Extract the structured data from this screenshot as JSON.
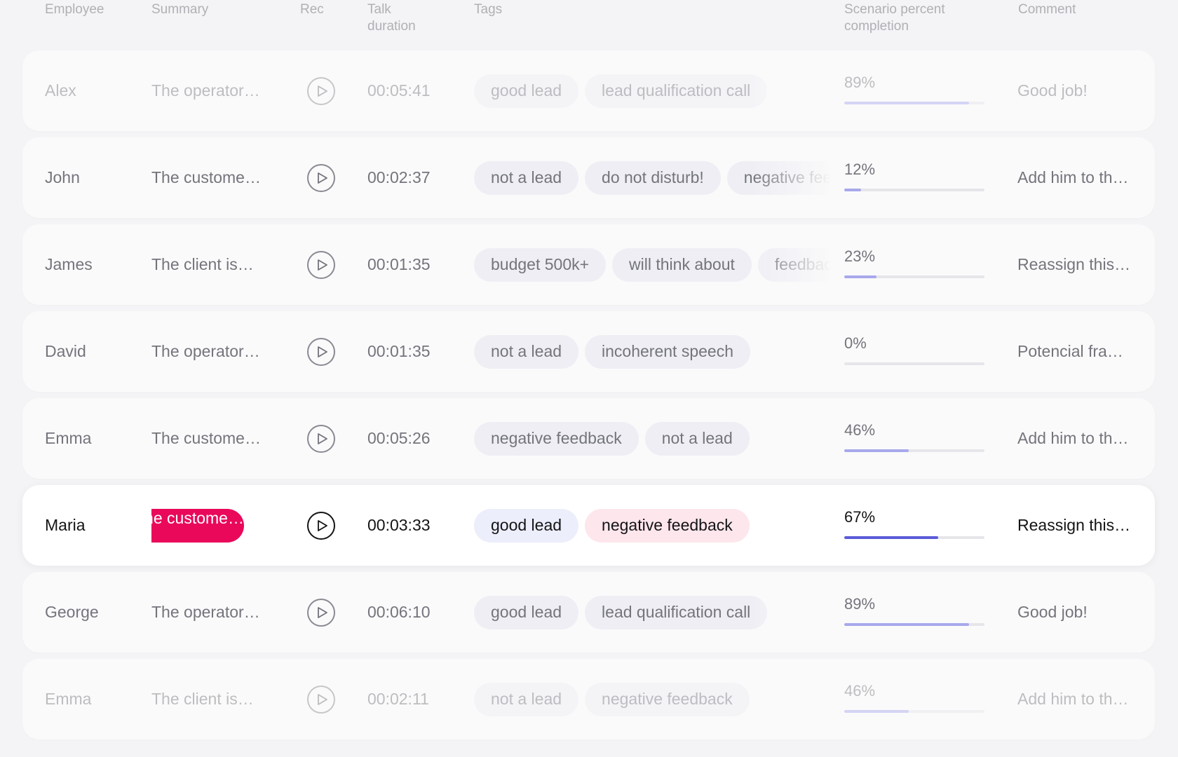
{
  "columns": {
    "employee": "Employee",
    "summary": "Summary",
    "rec": "Rec",
    "talk_duration_1": "Talk",
    "talk_duration_2": "duration",
    "tags": "Tags",
    "scenario_1": "Scenario percent",
    "scenario_2": "completion",
    "comment": "Comment"
  },
  "colors": {
    "accent": "#e9085a",
    "progress_active": "#5b5bd8",
    "progress_inactive": "#a8a8ec",
    "tag_bg": "#eeeef4",
    "tag_negative_bg": "#fde6ec"
  },
  "icons": {
    "play": "play-icon"
  },
  "rows": [
    {
      "employee": "Alex",
      "summary": "The operator…",
      "duration": "00:05:41",
      "tags": [
        "good lead",
        "lead qualification call"
      ],
      "percent_label": "89%",
      "percent": 89,
      "comment": "Good job!",
      "state": "faded"
    },
    {
      "employee": "John",
      "summary": "The custome…",
      "duration": "00:02:37",
      "tags": [
        "not a lead",
        "do not disturb!",
        "negative feedback"
      ],
      "percent_label": "12%",
      "percent": 12,
      "comment": "Add him to th…",
      "state": "normal"
    },
    {
      "employee": "James",
      "summary": "The client is…",
      "duration": "00:01:35",
      "tags": [
        "budget 500k+",
        "will think about",
        "feedback"
      ],
      "percent_label": "23%",
      "percent": 23,
      "comment": "Reassign this…",
      "state": "normal"
    },
    {
      "employee": "David",
      "summary": "The operator…",
      "duration": "00:01:35",
      "tags": [
        "not a lead",
        "incoherent speech"
      ],
      "percent_label": "0%",
      "percent": 0,
      "comment": "Potencial fra…",
      "state": "normal"
    },
    {
      "employee": "Emma",
      "summary": "The custome…",
      "duration": "00:05:26",
      "tags": [
        "negative feedback",
        "not a lead"
      ],
      "percent_label": "46%",
      "percent": 46,
      "comment": "Add him to th…",
      "state": "normal"
    },
    {
      "employee": "Maria",
      "summary": "The custome…",
      "duration": "00:03:33",
      "tags": [
        "good lead",
        "negative feedback"
      ],
      "percent_label": "67%",
      "percent": 67,
      "comment": "Reassign this…",
      "state": "active"
    },
    {
      "employee": "George",
      "summary": "The operator…",
      "duration": "00:06:10",
      "tags": [
        "good lead",
        "lead qualification call"
      ],
      "percent_label": "89%",
      "percent": 89,
      "comment": "Good job!",
      "state": "normal"
    },
    {
      "employee": "Emma",
      "summary": "The client is…",
      "duration": "00:02:11",
      "tags": [
        "not a lead",
        "negative feedback"
      ],
      "percent_label": "46%",
      "percent": 46,
      "comment": "Add him to th…",
      "state": "faded"
    }
  ]
}
